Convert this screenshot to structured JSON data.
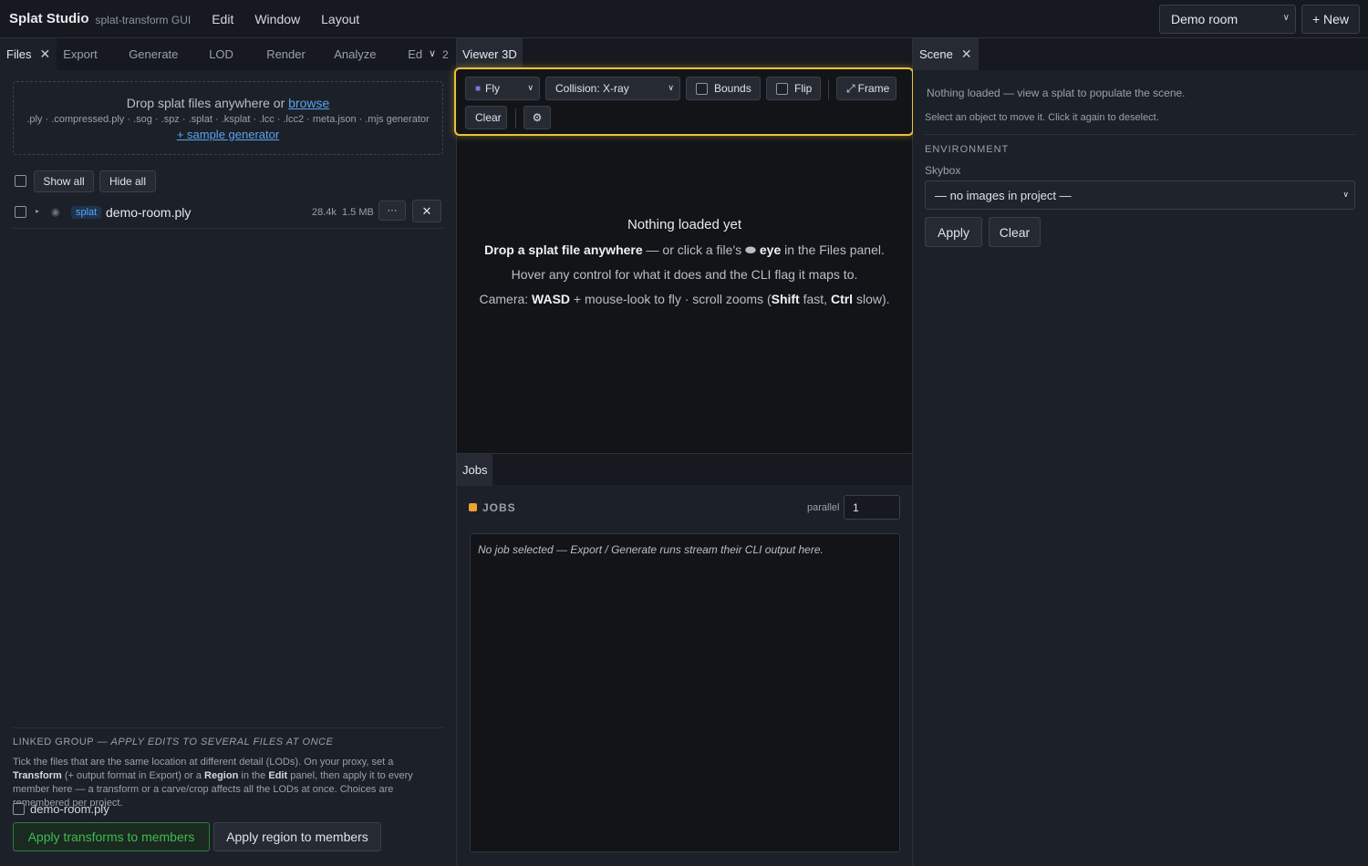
{
  "app": {
    "name": "Splat Studio",
    "subtitle": "splat-transform GUI"
  },
  "menu": [
    "Edit",
    "Window",
    "Layout"
  ],
  "project": {
    "selected": "Demo room",
    "new_label": "+ New"
  },
  "left_tabs": [
    "Files",
    "Export",
    "Generate",
    "LOD",
    "Render",
    "Analyze",
    "Ed"
  ],
  "left_overflow_count": "2",
  "dropzone": {
    "text": "Drop splat files anywhere or",
    "browse": "browse",
    "formats": ".ply · .compressed.ply · .sog · .spz · .splat · .ksplat · .lcc · .lcc2 · meta.json · .mjs generator",
    "sample": "+ sample generator"
  },
  "files_controls": {
    "show_all": "Show all",
    "hide_all": "Hide all"
  },
  "files": [
    {
      "type": "splat",
      "name": "demo-room.ply",
      "count": "28.4k",
      "size": "1.5 MB",
      "more": "···",
      "remove": "✕"
    }
  ],
  "linked_group": {
    "heading_a": "LINKED GROUP — ",
    "heading_b": "APPLY EDITS TO SEVERAL FILES AT ONCE",
    "desc_1": "Tick the files that are the same location at different detail (LODs). On your proxy, set a",
    "desc_b1": "Transform",
    "desc_2": "(+ output format in Export) or a",
    "desc_b2": "Region",
    "desc_3": "in the",
    "desc_b3": "Edit",
    "desc_4": "panel, then apply it to every member here —",
    "desc_5": "a transform or a carve/crop affects all the LODs at once. Choices are remembered per project.",
    "member": "demo-room.ply",
    "apply_transforms": "Apply transforms to members",
    "apply_region": "Apply region to members"
  },
  "viewer": {
    "tab": "Viewer 3D",
    "mode": "Fly",
    "collision": "Collision: X-ray",
    "bounds": "Bounds",
    "flip": "Flip",
    "frame": "Frame",
    "clear": "Clear",
    "settings_icon": "⚙",
    "empty_title": "Nothing loaded yet",
    "line1_b": "Drop a splat file anywhere",
    "line1_a": " — or click a file's ",
    "line1_b2": "eye",
    "line1_c": " in the Files panel.",
    "line2": "Hover any control for what it does and the CLI flag it maps to.",
    "line3_a": "Camera: ",
    "line3_b": "WASD",
    "line3_c": " + mouse-look to fly · scroll zooms (",
    "line3_d": "Shift",
    "line3_e": " fast, ",
    "line3_f": "Ctrl",
    "line3_g": " slow)."
  },
  "jobs": {
    "tab": "Jobs",
    "heading": "JOBS",
    "parallel_label": "parallel",
    "parallel_value": "1",
    "empty": "No job selected — Export / Generate runs stream their CLI output here.",
    "accent": "#f0a030"
  },
  "scene": {
    "tab": "Scene",
    "empty": "Nothing loaded — view a splat to populate the scene.",
    "hint": "Select an object to move it. Click it again to deselect.",
    "env_heading": "ENVIRONMENT",
    "skybox_label": "Skybox",
    "skybox_value": "— no images in project —",
    "apply": "Apply",
    "clear": "Clear"
  },
  "colors": {
    "accent_blue": "#5aa4f0",
    "highlight_yellow": "#e9c23a",
    "apply_green": "#3fb950"
  }
}
